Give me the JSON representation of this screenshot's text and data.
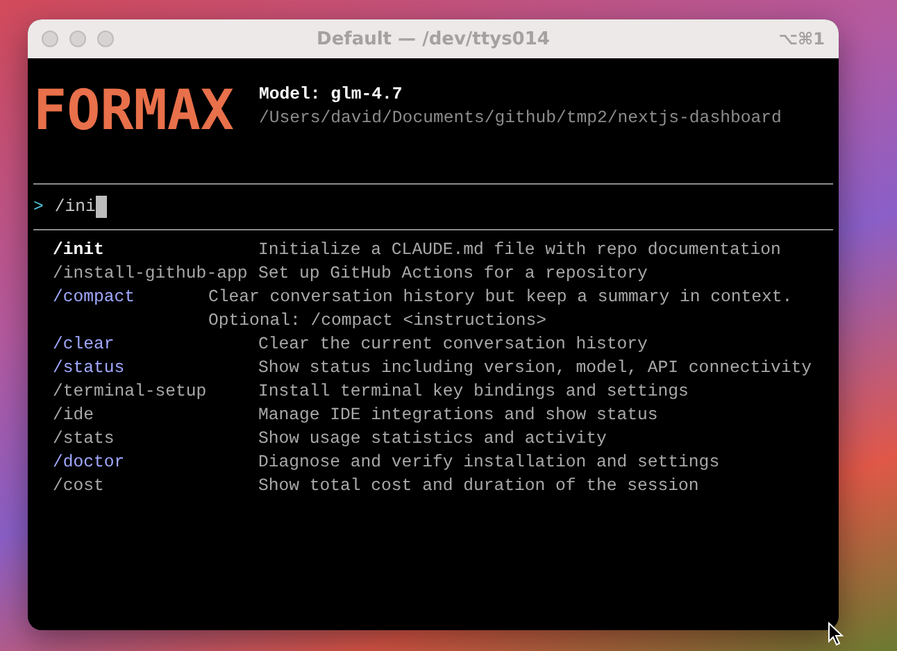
{
  "window": {
    "title": "Default — /dev/ttys014",
    "shortcut": "⌥⌘1"
  },
  "banner": {
    "logo": "FORMAX",
    "model": "Model: glm-4.7",
    "path": "/Users/david/Documents/github/tmp2/nextjs-dashboard"
  },
  "prompt": {
    "symbol": ">",
    "value": "/ini"
  },
  "commands": [
    {
      "name": "/init",
      "kind": "selected",
      "description": [
        "Initialize a CLAUDE.md file with repo documentation"
      ]
    },
    {
      "name": "/install-github-app",
      "kind": "plain",
      "description": [
        "Set up GitHub Actions for a repository"
      ]
    },
    {
      "name": "/compact",
      "kind": "builtin",
      "description": [
        "Clear conversation history but keep a summary in context.",
        "Optional: /compact <instructions>"
      ]
    },
    {
      "name": "/clear",
      "kind": "builtin",
      "description": [
        "Clear the current conversation history"
      ]
    },
    {
      "name": "/status",
      "kind": "builtin",
      "description": [
        "Show status including version, model, API connectivity"
      ]
    },
    {
      "name": "/terminal-setup",
      "kind": "plain",
      "description": [
        "Install terminal key bindings and settings"
      ]
    },
    {
      "name": "/ide",
      "kind": "plain",
      "description": [
        "Manage IDE integrations and show status"
      ]
    },
    {
      "name": "/stats",
      "kind": "plain",
      "description": [
        "Show usage statistics and activity"
      ]
    },
    {
      "name": "/doctor",
      "kind": "builtin",
      "description": [
        "Diagnose and verify installation and settings"
      ]
    },
    {
      "name": "/cost",
      "kind": "plain",
      "description": [
        "Show total cost and duration of the session"
      ]
    }
  ]
}
